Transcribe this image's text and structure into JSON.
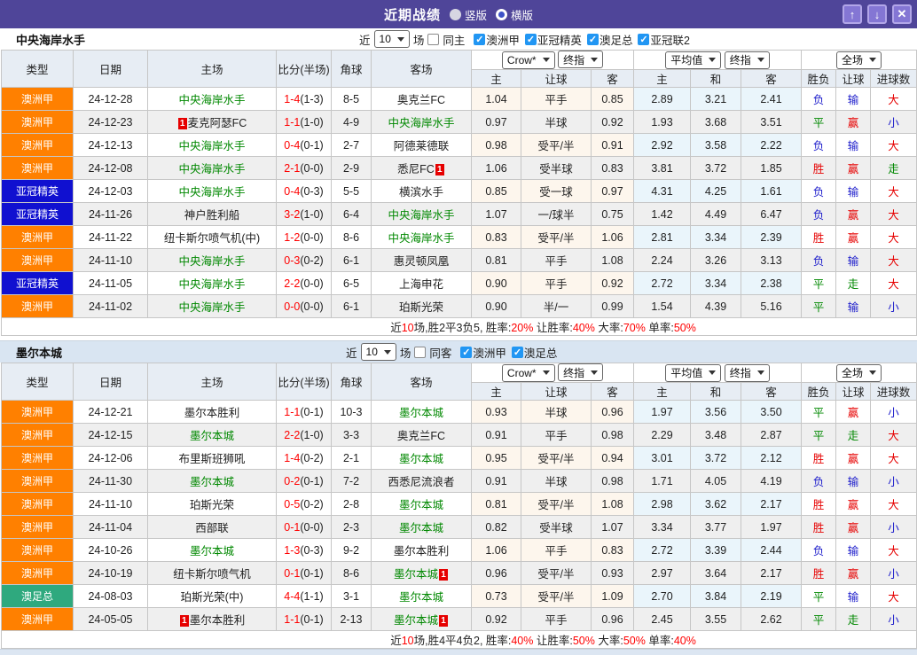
{
  "title_bar": {
    "title": "近期战绩",
    "radios": [
      {
        "label": "竖版",
        "selected": false
      },
      {
        "label": "横版",
        "selected": true
      }
    ],
    "buttons": {
      "up": "↑",
      "down": "↓",
      "close": "✕"
    }
  },
  "columns": {
    "left": [
      "类型",
      "日期",
      "主场",
      "比分(半场)",
      "角球",
      "客场"
    ],
    "dropdowns": [
      "Crow*",
      "终指",
      "平均值",
      "终指",
      "全场"
    ],
    "sub": [
      "主",
      "让球",
      "客",
      "主",
      "和",
      "客",
      "胜负",
      "让球",
      "进球数"
    ]
  },
  "colors": {
    "title_bar": "#4F4599",
    "aleague_badge": "#FF8000",
    "acl_elite_badge": "#1010D0",
    "aus_cup_badge": "#2FA97E",
    "self_team_green": "#008800",
    "score_red": "#FF0000",
    "win_red": "#E60000",
    "draw_green": "#008800",
    "lose_blue": "#2121CC",
    "checkbox_blue": "#2196F3"
  },
  "sections": [
    {
      "team": "中央海岸水手",
      "filter": {
        "near_label": "近",
        "games_value": "10",
        "games_label": "场",
        "same_label": "同主",
        "same_checked": false,
        "leagues": [
          {
            "label": "澳洲甲",
            "checked": true
          },
          {
            "label": "亚冠精英",
            "checked": true
          },
          {
            "label": "澳足总",
            "checked": true
          },
          {
            "label": "亚冠联2",
            "checked": true
          }
        ]
      },
      "rows": [
        {
          "league": "澳洲甲",
          "type": "aleague",
          "date": "24-12-28",
          "home": "中央海岸水手",
          "home_self": true,
          "home_card": false,
          "score": "1-4",
          "half": "(1-3)",
          "corners": "8-5",
          "away": "奥克兰FC",
          "away_self": false,
          "away_card": false,
          "odds": [
            "1.04",
            "平手",
            "0.85",
            "2.89",
            "3.21",
            "2.41"
          ],
          "results": [
            [
              "负",
              "b"
            ],
            [
              "输",
              "b"
            ],
            [
              "大",
              "r"
            ]
          ]
        },
        {
          "league": "澳洲甲",
          "type": "aleague",
          "date": "24-12-23",
          "home": "麦克阿瑟FC",
          "home_self": false,
          "home_card": true,
          "score": "1-1",
          "half": "(1-0)",
          "corners": "4-9",
          "away": "中央海岸水手",
          "away_self": true,
          "away_card": false,
          "odds": [
            "0.97",
            "半球",
            "0.92",
            "1.93",
            "3.68",
            "3.51"
          ],
          "results": [
            [
              "平",
              "g"
            ],
            [
              "赢",
              "r"
            ],
            [
              "小",
              "b"
            ]
          ]
        },
        {
          "league": "澳洲甲",
          "type": "aleague",
          "date": "24-12-13",
          "home": "中央海岸水手",
          "home_self": true,
          "home_card": false,
          "score": "0-4",
          "half": "(0-1)",
          "corners": "2-7",
          "away": "阿德莱德联",
          "away_self": false,
          "away_card": false,
          "odds": [
            "0.98",
            "受平/半",
            "0.91",
            "2.92",
            "3.58",
            "2.22"
          ],
          "results": [
            [
              "负",
              "b"
            ],
            [
              "输",
              "b"
            ],
            [
              "大",
              "r"
            ]
          ]
        },
        {
          "league": "澳洲甲",
          "type": "aleague",
          "date": "24-12-08",
          "home": "中央海岸水手",
          "home_self": true,
          "home_card": false,
          "score": "2-1",
          "half": "(0-0)",
          "corners": "2-9",
          "away": "悉尼FC",
          "away_self": false,
          "away_card": true,
          "odds": [
            "1.06",
            "受半球",
            "0.83",
            "3.81",
            "3.72",
            "1.85"
          ],
          "results": [
            [
              "胜",
              "r"
            ],
            [
              "赢",
              "r"
            ],
            [
              "走",
              "g"
            ]
          ]
        },
        {
          "league": "亚冠精英",
          "type": "acl",
          "date": "24-12-03",
          "home": "中央海岸水手",
          "home_self": true,
          "home_card": false,
          "score": "0-4",
          "half": "(0-3)",
          "corners": "5-5",
          "away": "横滨水手",
          "away_self": false,
          "away_card": false,
          "odds": [
            "0.85",
            "受一球",
            "0.97",
            "4.31",
            "4.25",
            "1.61"
          ],
          "results": [
            [
              "负",
              "b"
            ],
            [
              "输",
              "b"
            ],
            [
              "大",
              "r"
            ]
          ]
        },
        {
          "league": "亚冠精英",
          "type": "acl",
          "date": "24-11-26",
          "home": "神户胜利船",
          "home_self": false,
          "home_card": false,
          "score": "3-2",
          "half": "(1-0)",
          "corners": "6-4",
          "away": "中央海岸水手",
          "away_self": true,
          "away_card": false,
          "odds": [
            "1.07",
            "一/球半",
            "0.75",
            "1.42",
            "4.49",
            "6.47"
          ],
          "results": [
            [
              "负",
              "b"
            ],
            [
              "赢",
              "r"
            ],
            [
              "大",
              "r"
            ]
          ]
        },
        {
          "league": "澳洲甲",
          "type": "aleague",
          "date": "24-11-22",
          "home": "纽卡斯尔喷气机(中)",
          "home_self": false,
          "home_card": false,
          "score": "1-2",
          "half": "(0-0)",
          "corners": "8-6",
          "away": "中央海岸水手",
          "away_self": true,
          "away_card": false,
          "odds": [
            "0.83",
            "受平/半",
            "1.06",
            "2.81",
            "3.34",
            "2.39"
          ],
          "results": [
            [
              "胜",
              "r"
            ],
            [
              "赢",
              "r"
            ],
            [
              "大",
              "r"
            ]
          ]
        },
        {
          "league": "澳洲甲",
          "type": "aleague",
          "date": "24-11-10",
          "home": "中央海岸水手",
          "home_self": true,
          "home_card": false,
          "score": "0-3",
          "half": "(0-2)",
          "corners": "6-1",
          "away": "惠灵顿凤凰",
          "away_self": false,
          "away_card": false,
          "odds": [
            "0.81",
            "平手",
            "1.08",
            "2.24",
            "3.26",
            "3.13"
          ],
          "results": [
            [
              "负",
              "b"
            ],
            [
              "输",
              "b"
            ],
            [
              "大",
              "r"
            ]
          ]
        },
        {
          "league": "亚冠精英",
          "type": "acl",
          "date": "24-11-05",
          "home": "中央海岸水手",
          "home_self": true,
          "home_card": false,
          "score": "2-2",
          "half": "(0-0)",
          "corners": "6-5",
          "away": "上海申花",
          "away_self": false,
          "away_card": false,
          "odds": [
            "0.90",
            "平手",
            "0.92",
            "2.72",
            "3.34",
            "2.38"
          ],
          "results": [
            [
              "平",
              "g"
            ],
            [
              "走",
              "g"
            ],
            [
              "大",
              "r"
            ]
          ]
        },
        {
          "league": "澳洲甲",
          "type": "aleague",
          "date": "24-11-02",
          "home": "中央海岸水手",
          "home_self": true,
          "home_card": false,
          "score": "0-0",
          "half": "(0-0)",
          "corners": "6-1",
          "away": "珀斯光荣",
          "away_self": false,
          "away_card": false,
          "odds": [
            "0.90",
            "半/一",
            "0.99",
            "1.54",
            "4.39",
            "5.16"
          ],
          "results": [
            [
              "平",
              "g"
            ],
            [
              "输",
              "b"
            ],
            [
              "小",
              "b"
            ]
          ]
        }
      ],
      "footer": [
        [
          "近",
          "k"
        ],
        [
          "10",
          "r"
        ],
        [
          "场,胜2平3负5, 胜率:",
          "k"
        ],
        [
          "20%",
          "r"
        ],
        [
          " 让胜率:",
          "k"
        ],
        [
          "40%",
          "r"
        ],
        [
          " 大率:",
          "k"
        ],
        [
          "70%",
          "r"
        ],
        [
          " 单率:",
          "k"
        ],
        [
          "50%",
          "r"
        ]
      ]
    },
    {
      "team": "墨尔本城",
      "filter": {
        "near_label": "近",
        "games_value": "10",
        "games_label": "场",
        "same_label": "同客",
        "same_checked": false,
        "leagues": [
          {
            "label": "澳洲甲",
            "checked": true
          },
          {
            "label": "澳足总",
            "checked": true
          }
        ]
      },
      "rows": [
        {
          "league": "澳洲甲",
          "type": "aleague",
          "date": "24-12-21",
          "home": "墨尔本胜利",
          "home_self": false,
          "home_card": false,
          "score": "1-1",
          "half": "(0-1)",
          "corners": "10-3",
          "away": "墨尔本城",
          "away_self": true,
          "away_card": false,
          "odds": [
            "0.93",
            "半球",
            "0.96",
            "1.97",
            "3.56",
            "3.50"
          ],
          "results": [
            [
              "平",
              "g"
            ],
            [
              "赢",
              "r"
            ],
            [
              "小",
              "b"
            ]
          ]
        },
        {
          "league": "澳洲甲",
          "type": "aleague",
          "date": "24-12-15",
          "home": "墨尔本城",
          "home_self": true,
          "home_card": false,
          "score": "2-2",
          "half": "(1-0)",
          "corners": "3-3",
          "away": "奥克兰FC",
          "away_self": false,
          "away_card": false,
          "odds": [
            "0.91",
            "平手",
            "0.98",
            "2.29",
            "3.48",
            "2.87"
          ],
          "results": [
            [
              "平",
              "g"
            ],
            [
              "走",
              "g"
            ],
            [
              "大",
              "r"
            ]
          ]
        },
        {
          "league": "澳洲甲",
          "type": "aleague",
          "date": "24-12-06",
          "home": "布里斯班狮吼",
          "home_self": false,
          "home_card": false,
          "score": "1-4",
          "half": "(0-2)",
          "corners": "2-1",
          "away": "墨尔本城",
          "away_self": true,
          "away_card": false,
          "odds": [
            "0.95",
            "受平/半",
            "0.94",
            "3.01",
            "3.72",
            "2.12"
          ],
          "results": [
            [
              "胜",
              "r"
            ],
            [
              "赢",
              "r"
            ],
            [
              "大",
              "r"
            ]
          ]
        },
        {
          "league": "澳洲甲",
          "type": "aleague",
          "date": "24-11-30",
          "home": "墨尔本城",
          "home_self": true,
          "home_card": false,
          "score": "0-2",
          "half": "(0-1)",
          "corners": "7-2",
          "away": "西悉尼流浪者",
          "away_self": false,
          "away_card": false,
          "odds": [
            "0.91",
            "半球",
            "0.98",
            "1.71",
            "4.05",
            "4.19"
          ],
          "results": [
            [
              "负",
              "b"
            ],
            [
              "输",
              "b"
            ],
            [
              "小",
              "b"
            ]
          ]
        },
        {
          "league": "澳洲甲",
          "type": "aleague",
          "date": "24-11-10",
          "home": "珀斯光荣",
          "home_self": false,
          "home_card": false,
          "score": "0-5",
          "half": "(0-2)",
          "corners": "2-8",
          "away": "墨尔本城",
          "away_self": true,
          "away_card": false,
          "odds": [
            "0.81",
            "受平/半",
            "1.08",
            "2.98",
            "3.62",
            "2.17"
          ],
          "results": [
            [
              "胜",
              "r"
            ],
            [
              "赢",
              "r"
            ],
            [
              "大",
              "r"
            ]
          ]
        },
        {
          "league": "澳洲甲",
          "type": "aleague",
          "date": "24-11-04",
          "home": "西部联",
          "home_self": false,
          "home_card": false,
          "score": "0-1",
          "half": "(0-0)",
          "corners": "2-3",
          "away": "墨尔本城",
          "away_self": true,
          "away_card": false,
          "odds": [
            "0.82",
            "受半球",
            "1.07",
            "3.34",
            "3.77",
            "1.97"
          ],
          "results": [
            [
              "胜",
              "r"
            ],
            [
              "赢",
              "r"
            ],
            [
              "小",
              "b"
            ]
          ]
        },
        {
          "league": "澳洲甲",
          "type": "aleague",
          "date": "24-10-26",
          "home": "墨尔本城",
          "home_self": true,
          "home_card": false,
          "score": "1-3",
          "half": "(0-3)",
          "corners": "9-2",
          "away": "墨尔本胜利",
          "away_self": false,
          "away_card": false,
          "odds": [
            "1.06",
            "平手",
            "0.83",
            "2.72",
            "3.39",
            "2.44"
          ],
          "results": [
            [
              "负",
              "b"
            ],
            [
              "输",
              "b"
            ],
            [
              "大",
              "r"
            ]
          ]
        },
        {
          "league": "澳洲甲",
          "type": "aleague",
          "date": "24-10-19",
          "home": "纽卡斯尔喷气机",
          "home_self": false,
          "home_card": false,
          "score": "0-1",
          "half": "(0-1)",
          "corners": "8-6",
          "away": "墨尔本城",
          "away_self": true,
          "away_card": true,
          "odds": [
            "0.96",
            "受平/半",
            "0.93",
            "2.97",
            "3.64",
            "2.17"
          ],
          "results": [
            [
              "胜",
              "r"
            ],
            [
              "赢",
              "r"
            ],
            [
              "小",
              "b"
            ]
          ]
        },
        {
          "league": "澳足总",
          "type": "cup",
          "date": "24-08-03",
          "home": "珀斯光荣(中)",
          "home_self": false,
          "home_card": false,
          "score": "4-4",
          "half": "(1-1)",
          "corners": "3-1",
          "away": "墨尔本城",
          "away_self": true,
          "away_card": false,
          "odds": [
            "0.73",
            "受平/半",
            "1.09",
            "2.70",
            "3.84",
            "2.19"
          ],
          "results": [
            [
              "平",
              "g"
            ],
            [
              "输",
              "b"
            ],
            [
              "大",
              "r"
            ]
          ]
        },
        {
          "league": "澳洲甲",
          "type": "aleague",
          "date": "24-05-05",
          "home": "墨尔本胜利",
          "home_self": false,
          "home_card": true,
          "score": "1-1",
          "half": "(0-1)",
          "corners": "2-13",
          "away": "墨尔本城",
          "away_self": true,
          "away_card": true,
          "odds": [
            "0.92",
            "平手",
            "0.96",
            "2.45",
            "3.55",
            "2.62"
          ],
          "results": [
            [
              "平",
              "g"
            ],
            [
              "走",
              "g"
            ],
            [
              "小",
              "b"
            ]
          ]
        }
      ],
      "footer": [
        [
          "近",
          "k"
        ],
        [
          "10",
          "r"
        ],
        [
          "场,胜4平4负2, 胜率:",
          "k"
        ],
        [
          "40%",
          "r"
        ],
        [
          " 让胜率:",
          "k"
        ],
        [
          "50%",
          "r"
        ],
        [
          " 大率:",
          "k"
        ],
        [
          "50%",
          "r"
        ],
        [
          " 单率:",
          "k"
        ],
        [
          "40%",
          "r"
        ]
      ]
    }
  ]
}
